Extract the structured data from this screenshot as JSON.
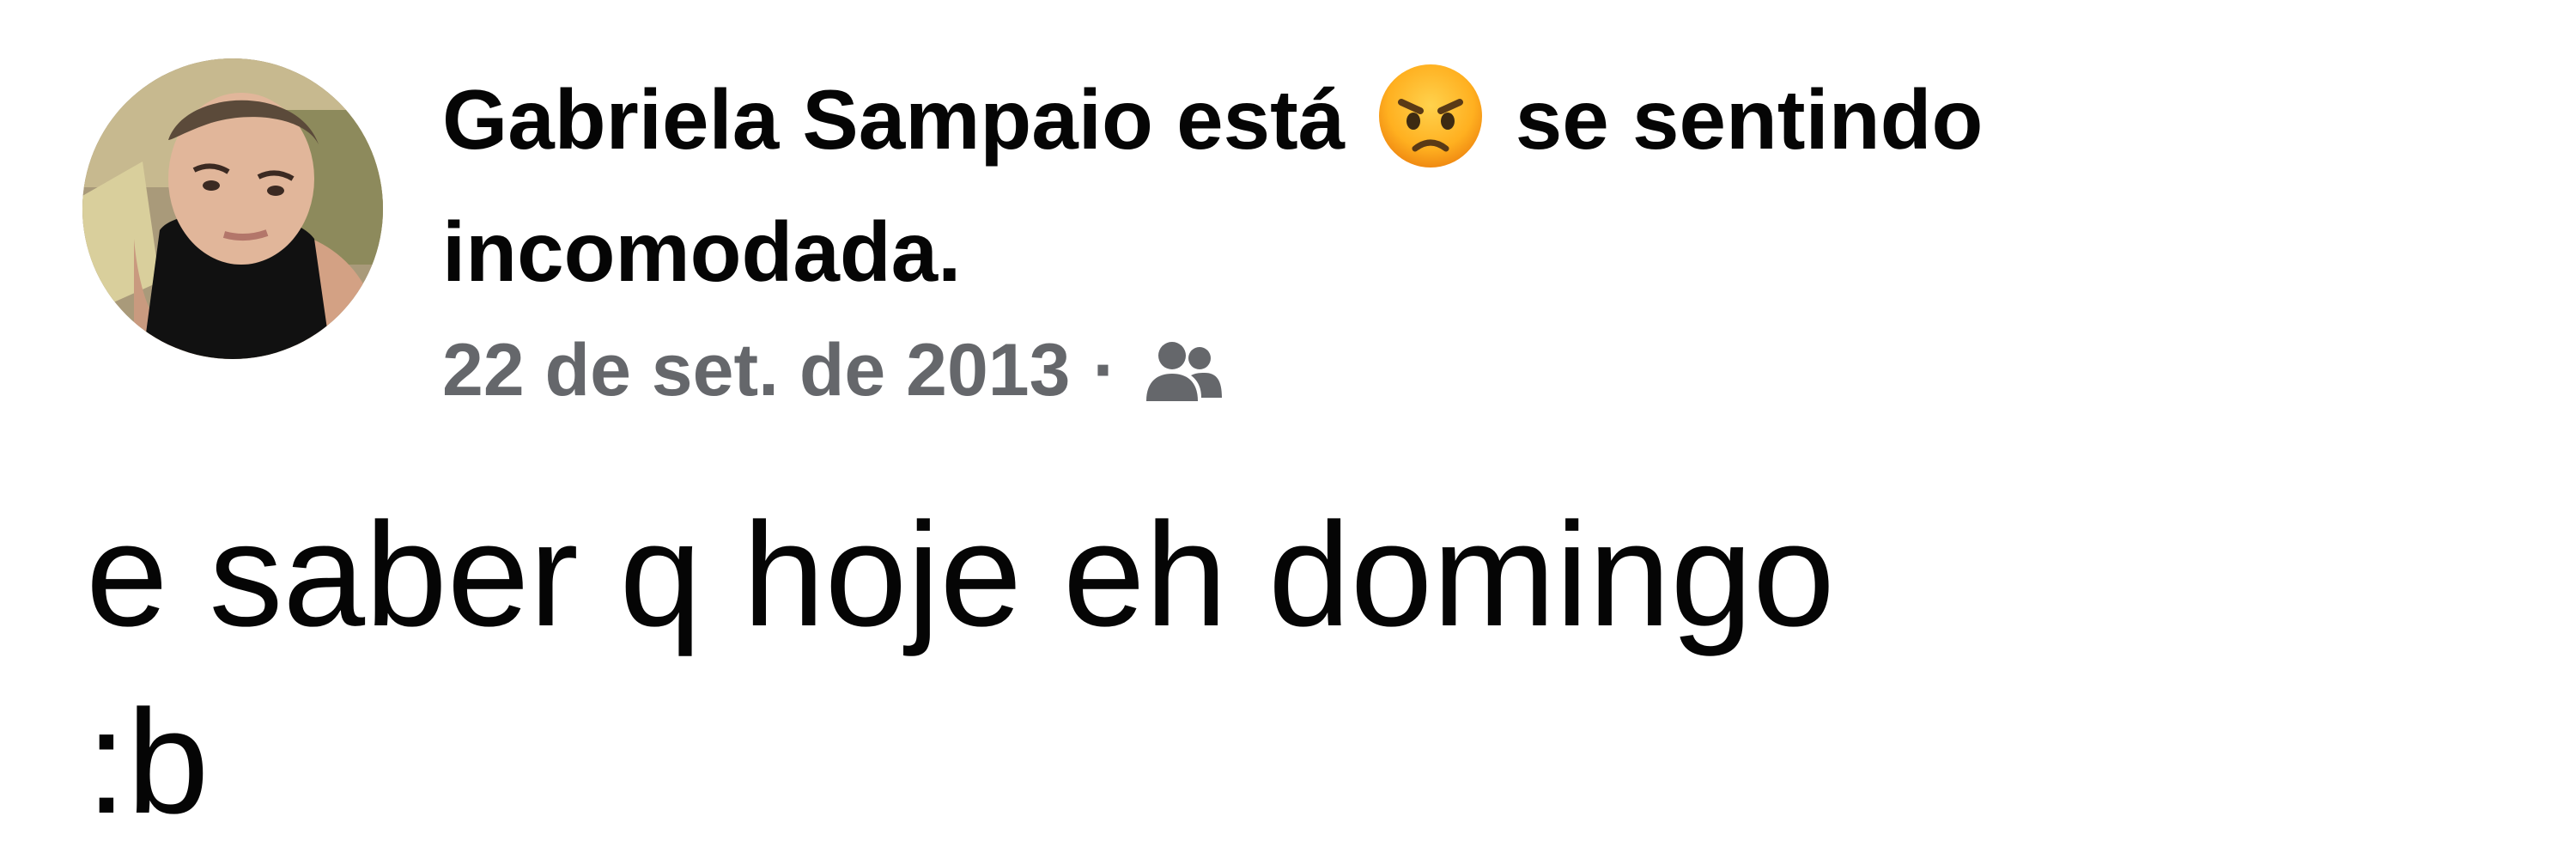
{
  "post": {
    "author": "Gabriela Sampaio",
    "feeling_verb": "está",
    "feeling_emoji": "angry-face-emoji",
    "feeling_text": "se sentindo incomodada.",
    "timestamp": "22 de set. de 2013",
    "separator": "·",
    "audience_icon": "friends-icon",
    "body_lines": [
      "e saber q hoje eh domingo",
      ":b"
    ]
  },
  "colors": {
    "text": "#050505",
    "meta": "#65676b",
    "background": "#ffffff"
  }
}
